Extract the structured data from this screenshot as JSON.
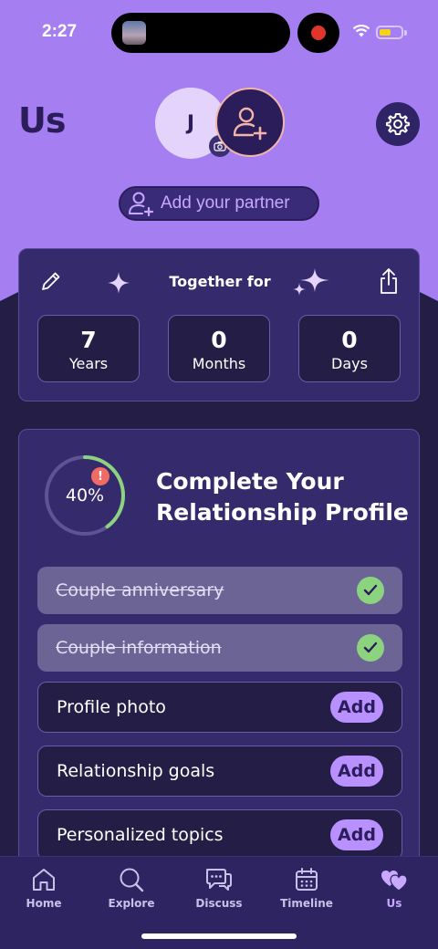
{
  "status_bar": {
    "time": "2:27"
  },
  "header": {
    "title": "Us",
    "user_initial": "J",
    "add_partner_label": "Add your partner"
  },
  "together": {
    "title": "Together for",
    "stats": [
      {
        "value": "7",
        "label": "Years"
      },
      {
        "value": "0",
        "label": "Months"
      },
      {
        "value": "0",
        "label": "Days"
      }
    ]
  },
  "profile": {
    "progress_text": "40%",
    "progress_fraction": 0.4,
    "alert": "!",
    "title_line1": "Complete Your",
    "title_line2": "Relationship Profile",
    "tasks": [
      {
        "label": "Couple anniversary",
        "status": "done"
      },
      {
        "label": "Couple information",
        "status": "done"
      },
      {
        "label": "Profile photo",
        "status": "todo",
        "action": "Add"
      },
      {
        "label": "Relationship goals",
        "status": "todo",
        "action": "Add"
      },
      {
        "label": "Personalized topics",
        "status": "todo",
        "action": "Add"
      }
    ]
  },
  "tabbar": {
    "tabs": [
      {
        "label": "Home",
        "icon": "home-icon"
      },
      {
        "label": "Explore",
        "icon": "search-icon"
      },
      {
        "label": "Discuss",
        "icon": "chat-bubbles-icon"
      },
      {
        "label": "Timeline",
        "icon": "calendar-icon"
      },
      {
        "label": "Us",
        "icon": "hearts-icon",
        "active": true
      }
    ]
  },
  "colors": {
    "header_bg": "#a57ff2",
    "page_bg": "#241d45",
    "card_bg": "#352a6b",
    "accent": "#b990ff",
    "success": "#8bd37e",
    "alert": "#f06b63"
  }
}
